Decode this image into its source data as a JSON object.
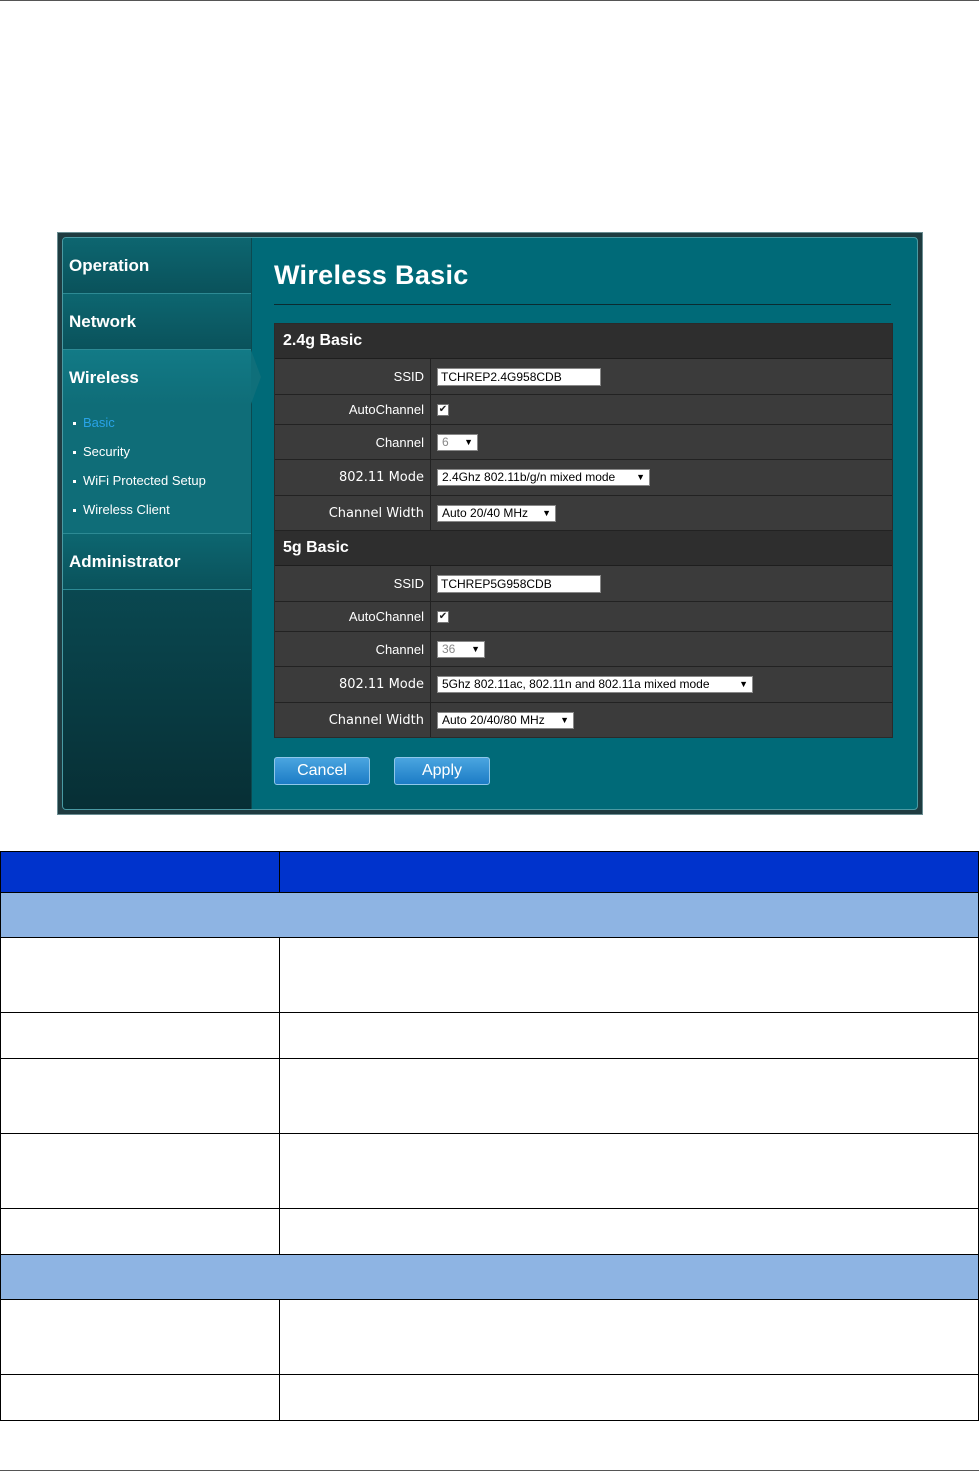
{
  "sidebar": {
    "sections": [
      "Operation",
      "Network",
      "Wireless",
      "Administrator"
    ],
    "wireless_items": [
      "Basic",
      "Security",
      "WiFi Protected Setup",
      "Wireless Client"
    ],
    "current_item": "Basic"
  },
  "page": {
    "title": "Wireless Basic"
  },
  "band24": {
    "heading": "2.4g Basic",
    "ssid_label": "SSID",
    "ssid_value": "TCHREP2.4G958CDB",
    "autochannel_label": "AutoChannel",
    "autochannel_checked": true,
    "channel_label": "Channel",
    "channel_value": "6",
    "mode_label": "802.11 Mode",
    "mode_value": "2.4Ghz 802.11b/g/n mixed mode",
    "width_label": "Channel Width",
    "width_value": "Auto 20/40 MHz"
  },
  "band5": {
    "heading": "5g Basic",
    "ssid_label": "SSID",
    "ssid_value": "TCHREP5G958CDB",
    "autochannel_label": "AutoChannel",
    "autochannel_checked": true,
    "channel_label": "Channel",
    "channel_value": "36",
    "mode_label": "802.11 Mode",
    "mode_value": "5Ghz 802.11ac, 802.11n and 802.11a mixed mode",
    "width_label": "Channel Width",
    "width_value": "Auto 20/40/80 MHz"
  },
  "buttons": {
    "cancel": "Cancel",
    "apply": "Apply"
  },
  "icons": {
    "checkbox": "check-icon",
    "dropdown": "triangle-down-icon"
  },
  "colors": {
    "panel_teal": "#006a78",
    "button_blue": "#1c7cc5",
    "doc_header": "#0033cc",
    "doc_band": "#8eb4e3"
  }
}
